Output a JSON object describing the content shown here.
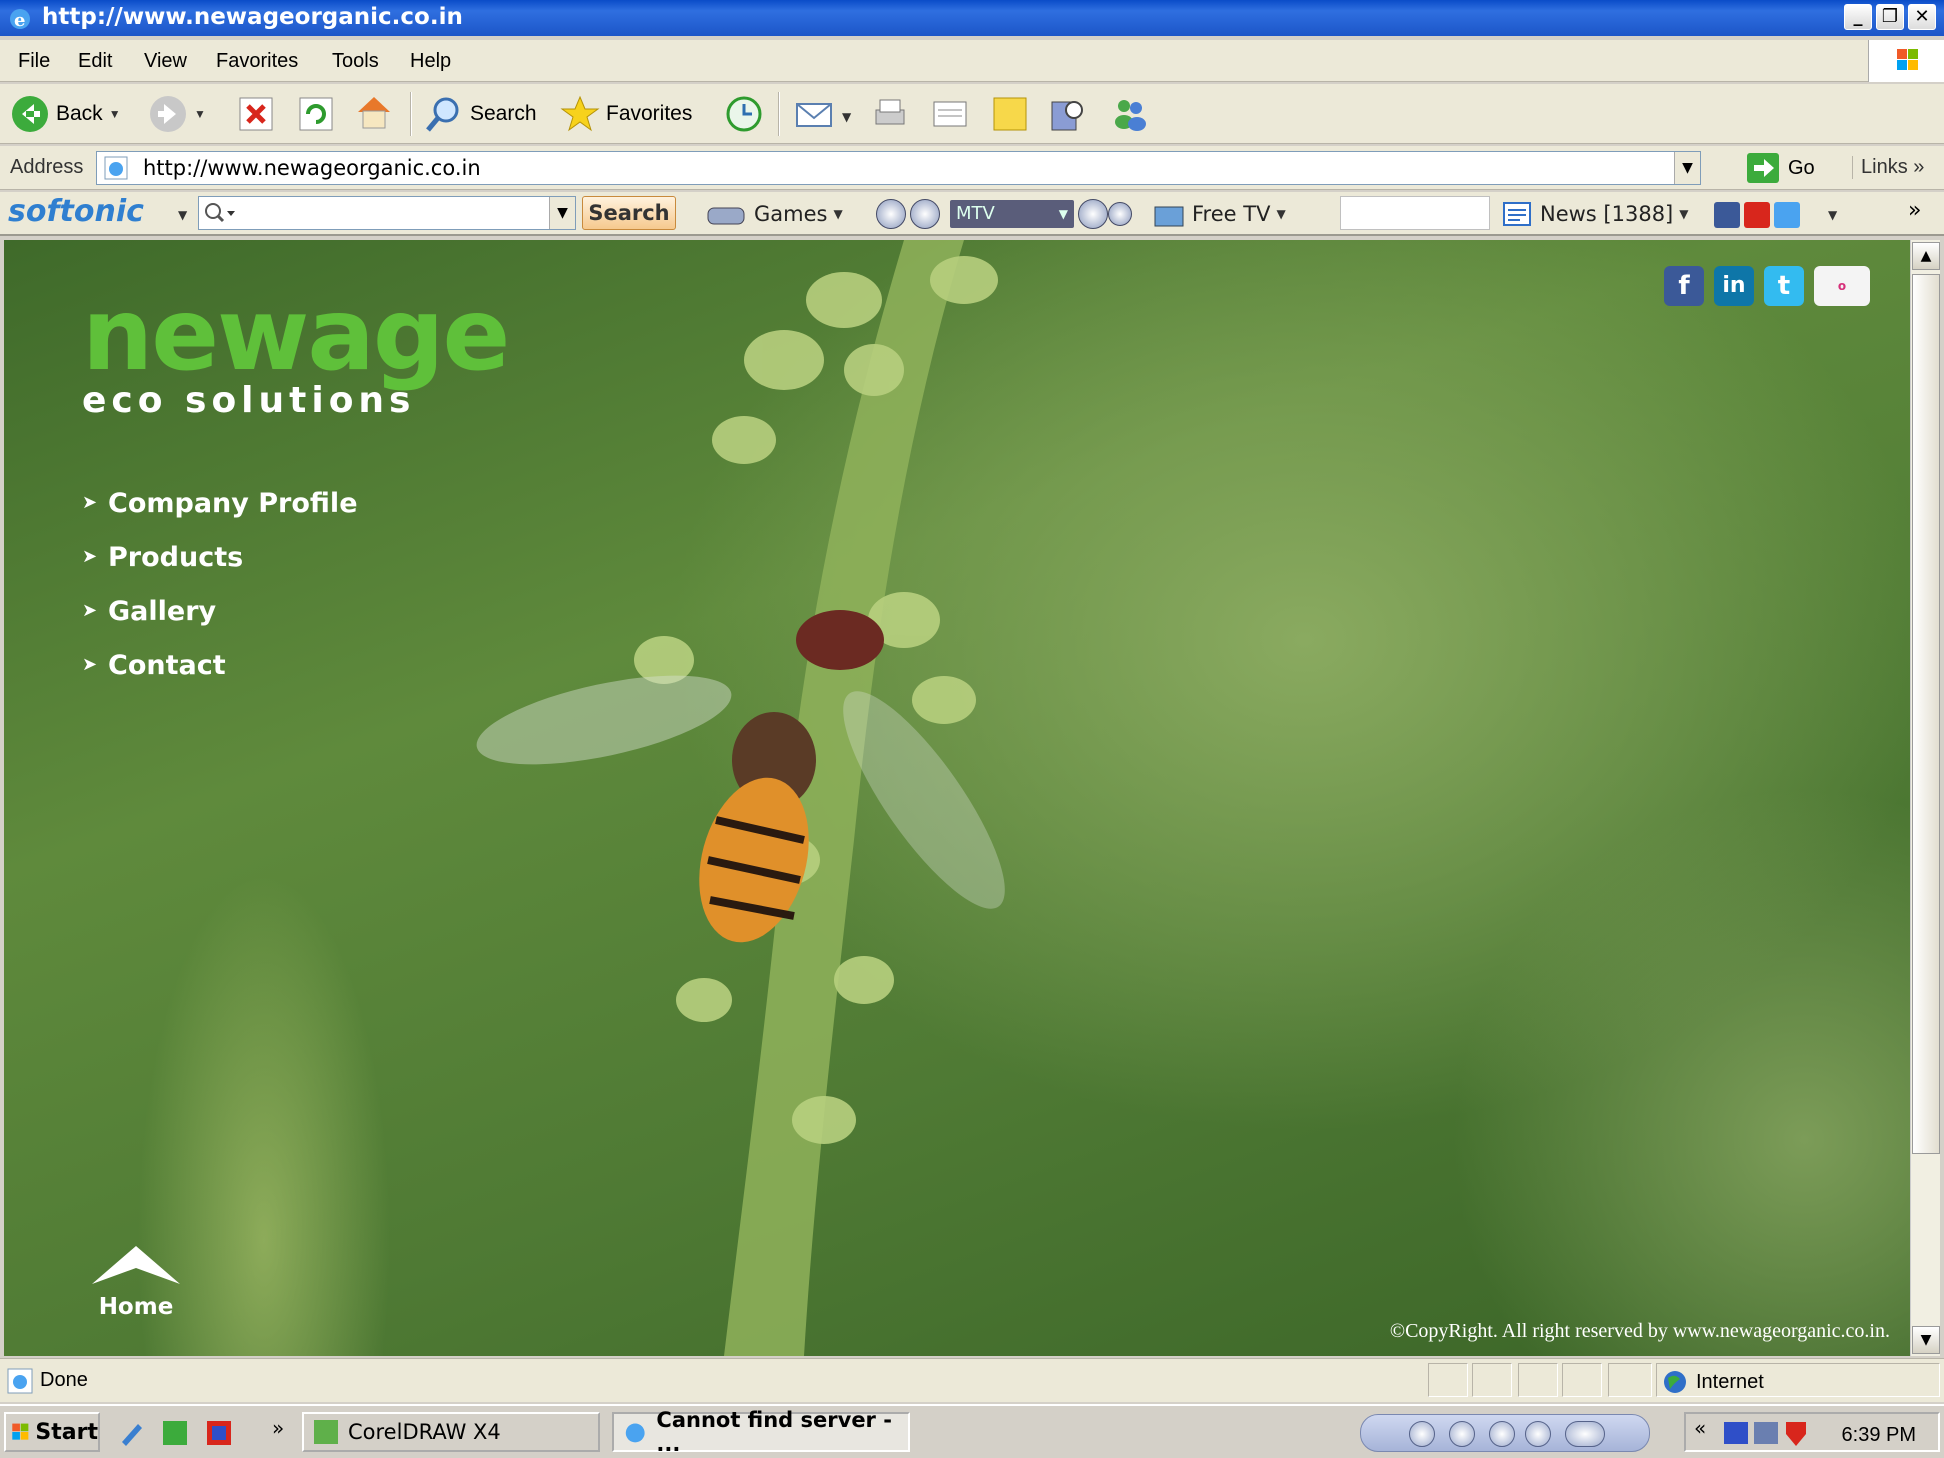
{
  "window": {
    "title": "http://www.newageorganic.co.in"
  },
  "menu": [
    "File",
    "Edit",
    "View",
    "Favorites",
    "Tools",
    "Help"
  ],
  "toolbar": {
    "back": "Back",
    "search": "Search",
    "favorites": "Favorites"
  },
  "address": {
    "label": "Address",
    "url": "http://www.newageorganic.co.in",
    "go": "Go",
    "links": "Links"
  },
  "softonic": {
    "logo": "softonic",
    "search_btn": "Search",
    "games": "Games",
    "station": "MTV",
    "free_tv": "Free TV",
    "news": "News [1388]"
  },
  "page": {
    "logo_word": "newage",
    "logo_sub": "eco solutions",
    "nav": [
      "Company Profile",
      "Products",
      "Gallery",
      "Contact"
    ],
    "social": [
      "facebook-icon",
      "linkedin-icon",
      "twitter-icon",
      "orkut-icon"
    ],
    "home": "Home",
    "copyright": "©CopyRight. All right reserved by www.newageorganic.co.in."
  },
  "status": {
    "text": "Done",
    "zone": "Internet"
  },
  "taskbar": {
    "start": "Start",
    "tasks": [
      "CorelDRAW X4",
      "Cannot find server - ..."
    ],
    "clock": "6:39 PM"
  },
  "colors": {
    "brand_green": "#5fc03a",
    "xp_blue": "#0a4cc8"
  }
}
